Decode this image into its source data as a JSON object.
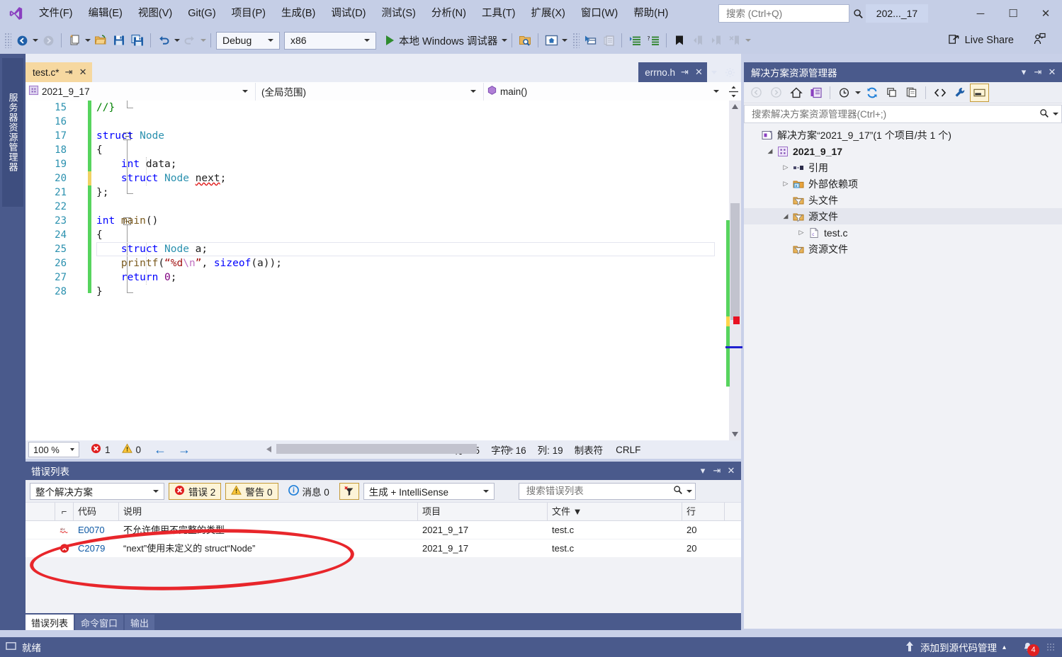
{
  "app": {
    "window_title": "202..._17",
    "logo_icon": "visual-studio-logo"
  },
  "menu": {
    "items": [
      {
        "label": "文件(F)",
        "key": "F"
      },
      {
        "label": "编辑(E)",
        "key": "E"
      },
      {
        "label": "视图(V)",
        "key": "V"
      },
      {
        "label": "Git(G)",
        "key": "G"
      },
      {
        "label": "项目(P)",
        "key": "P"
      },
      {
        "label": "生成(B)",
        "key": "B"
      },
      {
        "label": "调试(D)",
        "key": "D"
      },
      {
        "label": "测试(S)",
        "key": "S"
      },
      {
        "label": "分析(N)",
        "key": "N"
      },
      {
        "label": "工具(T)",
        "key": "T"
      },
      {
        "label": "扩展(X)",
        "key": "X"
      },
      {
        "label": "窗口(W)",
        "key": "W"
      },
      {
        "label": "帮助(H)",
        "key": "H"
      }
    ]
  },
  "search": {
    "placeholder": "搜索 (Ctrl+Q)",
    "value": "",
    "icon": "search-icon"
  },
  "window_buttons": {
    "minimize": "─",
    "maximize": "☐",
    "close": "✕"
  },
  "toolbar": {
    "config": "Debug",
    "platform": "x86",
    "run_label": "本地 Windows 调试器",
    "live_share": "Live Share"
  },
  "left_dock": {
    "tab_label": "服务器资源管理器"
  },
  "editor": {
    "active_tab": "test.c*",
    "inactive_tab": "errno.h",
    "nav": {
      "project": "2021_9_17",
      "scope": "(全局范围)",
      "member": "main()"
    },
    "code": [
      {
        "num": "15",
        "tokens": [
          {
            "t": "//}",
            "c": "cm"
          }
        ]
      },
      {
        "num": "16",
        "tokens": []
      },
      {
        "num": "17",
        "tokens": [
          {
            "t": "struct ",
            "c": "k"
          },
          {
            "t": "Node",
            "c": "t"
          }
        ]
      },
      {
        "num": "18",
        "tokens": [
          {
            "t": "{",
            "c": ""
          }
        ]
      },
      {
        "num": "19",
        "tokens": [
          {
            "t": "    ",
            "c": ""
          },
          {
            "t": "int",
            "c": "k"
          },
          {
            "t": " data;",
            "c": ""
          }
        ]
      },
      {
        "num": "20",
        "tokens": [
          {
            "t": "    ",
            "c": ""
          },
          {
            "t": "struct ",
            "c": "k"
          },
          {
            "t": "Node",
            "c": "t"
          },
          {
            "t": " ",
            "c": ""
          },
          {
            "t": "next",
            "c": "squig"
          },
          {
            "t": ";",
            "c": ""
          }
        ]
      },
      {
        "num": "21",
        "tokens": [
          {
            "t": "};",
            "c": ""
          }
        ]
      },
      {
        "num": "22",
        "tokens": []
      },
      {
        "num": "23",
        "tokens": [
          {
            "t": "int",
            "c": "k"
          },
          {
            "t": " ",
            "c": ""
          },
          {
            "t": "main",
            "c": "f"
          },
          {
            "t": "()",
            "c": ""
          }
        ]
      },
      {
        "num": "24",
        "tokens": [
          {
            "t": "{",
            "c": ""
          }
        ]
      },
      {
        "num": "25",
        "tokens": [
          {
            "t": "    ",
            "c": ""
          },
          {
            "t": "struct ",
            "c": "k"
          },
          {
            "t": "Node",
            "c": "t"
          },
          {
            "t": " a;",
            "c": ""
          }
        ]
      },
      {
        "num": "26",
        "tokens": [
          {
            "t": "    ",
            "c": ""
          },
          {
            "t": "printf",
            "c": "f"
          },
          {
            "t": "(",
            "c": ""
          },
          {
            "t": "“%d",
            "c": "s"
          },
          {
            "t": "\\n",
            "c": "esc"
          },
          {
            "t": "”",
            "c": "s"
          },
          {
            "t": ", ",
            "c": ""
          },
          {
            "t": "sizeof",
            "c": "k"
          },
          {
            "t": "(a));",
            "c": ""
          }
        ]
      },
      {
        "num": "27",
        "tokens": [
          {
            "t": "    ",
            "c": ""
          },
          {
            "t": "return",
            "c": "k"
          },
          {
            "t": " ",
            "c": ""
          },
          {
            "t": "0",
            "c": "num0"
          },
          {
            "t": ";",
            "c": ""
          }
        ]
      },
      {
        "num": "28",
        "tokens": [
          {
            "t": "}",
            "c": ""
          }
        ]
      }
    ],
    "status": {
      "zoom": "100 %",
      "error_count": "1",
      "warning_count": "0",
      "line_label": "行: 25",
      "char_label": "字符: 16",
      "col_label": "列: 19",
      "tab_label": "制表符",
      "eol_label": "CRLF"
    }
  },
  "solution_explorer": {
    "title": "解决方案资源管理器",
    "search_placeholder": "搜索解决方案资源管理器(Ctrl+;)",
    "tree": [
      {
        "label": "解决方案“2021_9_17”(1 个项目/共 1 个)",
        "indent": 0,
        "expander": "",
        "icon": "solution-icon",
        "bold": false,
        "selected": false
      },
      {
        "label": "2021_9_17",
        "indent": 1,
        "expander": "◢",
        "icon": "project-icon",
        "bold": true,
        "selected": false
      },
      {
        "label": "引用",
        "indent": 2,
        "expander": "▷",
        "icon": "references-icon",
        "bold": false,
        "selected": false
      },
      {
        "label": "外部依赖项",
        "indent": 2,
        "expander": "▷",
        "icon": "ext-deps-icon",
        "bold": false,
        "selected": false
      },
      {
        "label": "头文件",
        "indent": 2,
        "expander": "",
        "icon": "filter-folder-icon",
        "bold": false,
        "selected": false
      },
      {
        "label": "源文件",
        "indent": 2,
        "expander": "◢",
        "icon": "filter-folder-icon",
        "bold": false,
        "selected": true
      },
      {
        "label": "test.c",
        "indent": 3,
        "expander": "▷",
        "icon": "c-file-icon",
        "bold": false,
        "selected": false
      },
      {
        "label": "资源文件",
        "indent": 2,
        "expander": "",
        "icon": "filter-folder-icon",
        "bold": false,
        "selected": false
      }
    ]
  },
  "error_list": {
    "title": "错误列表",
    "scope_filter": "整个解决方案",
    "errors_toggle": "错误 2",
    "warnings_toggle": "警告 0",
    "messages_toggle": "消息 0",
    "source_filter": "生成 + IntelliSense",
    "search_placeholder": "搜索错误列表",
    "columns": [
      "",
      "",
      "代码",
      "说明",
      "项目",
      "文件 ▼",
      "行"
    ],
    "rows": [
      {
        "severity": "intellisense-squiggle-icon",
        "code": "E0070",
        "desc": "不允许使用不完整的类型",
        "project": "2021_9_17",
        "file": "test.c",
        "line": "20"
      },
      {
        "severity": "error-icon",
        "code": "C2079",
        "desc": "“next”使用未定义的 struct“Node”",
        "project": "2021_9_17",
        "file": "test.c",
        "line": "20"
      }
    ]
  },
  "bottom_tabs": [
    {
      "label": "错误列表",
      "active": true
    },
    {
      "label": "命令窗口",
      "active": false
    },
    {
      "label": "输出",
      "active": false
    }
  ],
  "status_bar": {
    "ready": "就绪",
    "source_control": "添加到源代码管理",
    "notification_count": "4"
  },
  "colors": {
    "chrome": "#c5cee6",
    "dock_blue": "#4a5a8c",
    "accent_tab": "#f6d8a0",
    "error_red": "#e81123",
    "annotation_red": "#e8262b",
    "link_blue": "#0b57a4",
    "keyword_blue": "#0000ff",
    "type_teal": "#2b91af",
    "string_red": "#a31515",
    "comment_green": "#008000"
  }
}
